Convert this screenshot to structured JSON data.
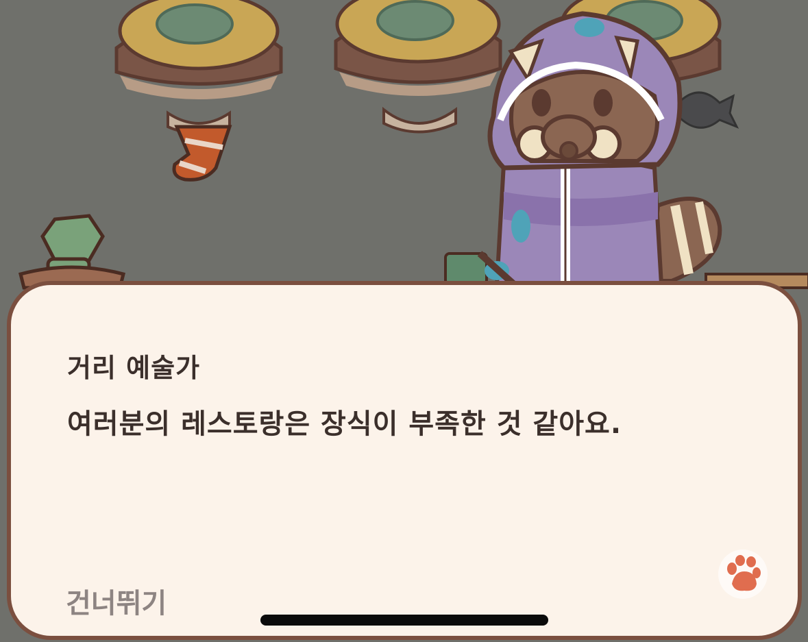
{
  "dialog": {
    "speaker": "거리 예술가",
    "message": "여러분의 레스토랑은 장식이 부족한 것 같아요.",
    "skip_label": "건너뛰기",
    "advance_icon": "paw-icon"
  },
  "colors": {
    "scene_bg": "#6f706b",
    "dialog_bg": "#fcf3ea",
    "dialog_border": "#7b4f3f",
    "text": "#3b2f2b",
    "skip_text": "#8d8482",
    "paw": "#e06d4f",
    "hood": "#9b87b8"
  }
}
